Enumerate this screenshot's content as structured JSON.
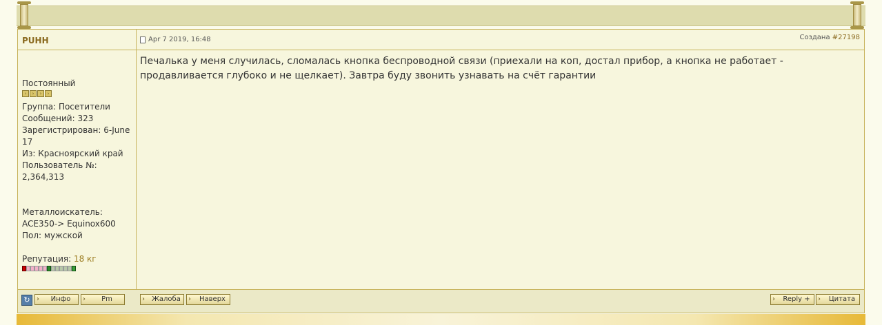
{
  "post": {
    "author": "PUHH",
    "date": "Apr 7 2019, 16:48",
    "created_prefix": "Создана",
    "post_id": "#27198",
    "message": "Печалька у меня случилась, сломалась кнопка беспроводной связи (приехали на коп, достал прибор, а кнопка не работает - продавливается глубоко и не щелкает). Завтра буду звонить узнавать на счёт гарантии"
  },
  "user": {
    "rank": "Постоянный",
    "group": "Группа: Посетители",
    "posts": "Сообщений: 323",
    "registered": "Зарегистрирован: 6-June 17",
    "location": "Из: Красноярский край",
    "user_number": "Пользователь №: 2,364,313",
    "detector": "Металлоискатель: ACE350-> Equinox600",
    "gender": "Пол: мужской",
    "rep_label": "Репутация:",
    "rep_value": "18 кг"
  },
  "buttons": {
    "info": "Инфо",
    "pm": "Pm",
    "complaint": "Жалоба",
    "top": "Наверх",
    "reply": "Reply +",
    "quote": "Цитата"
  }
}
